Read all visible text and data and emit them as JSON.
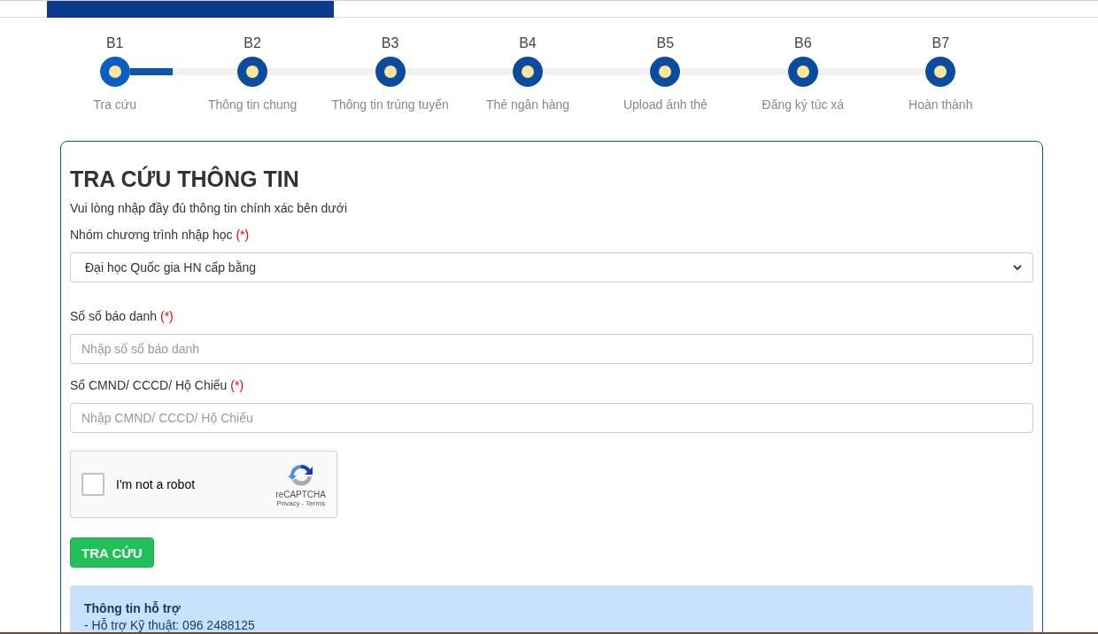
{
  "steps": [
    {
      "code": "B1",
      "label": "Tra cứu",
      "selected": true
    },
    {
      "code": "B2",
      "label": "Thông tin chung",
      "selected": false
    },
    {
      "code": "B3",
      "label": "Thông tin trúng tuyển",
      "selected": false
    },
    {
      "code": "B4",
      "label": "Thẻ ngân hàng",
      "selected": false
    },
    {
      "code": "B5",
      "label": "Upload ảnh thẻ",
      "selected": false
    },
    {
      "code": "B6",
      "label": "Đăng ký túc xá",
      "selected": false
    },
    {
      "code": "B7",
      "label": "Hoàn thành",
      "selected": false
    }
  ],
  "form": {
    "title": "TRA CỨU THÔNG TIN",
    "subtitle": "Vui lòng nhập đầy đủ thông tin chính xác bên dưới",
    "fields": [
      {
        "kind": "select",
        "label": "Nhóm chương trình nhập học",
        "required_mark": "(*)",
        "value": "Đại học Quốc gia HN cấp bằng"
      },
      {
        "kind": "input",
        "label": "Số số báo danh",
        "required_mark": "(*)",
        "placeholder": "Nhập số số báo danh"
      },
      {
        "kind": "input",
        "label": "Số CMND/ CCCD/ Hộ Chiếu",
        "required_mark": "(*)",
        "placeholder": "Nhập CMND/ CCCD/ Hộ Chiếu"
      }
    ],
    "captcha": {
      "label": "I'm not a robot",
      "checked": false,
      "brand": "reCAPTCHA",
      "links": "Privacy - Terms"
    },
    "submit": "TRA CỨU",
    "support": {
      "title": "Thông tin hỗ trợ",
      "lines": [
        "- Hỗ trợ Kỹ thuật: 096 2488125"
      ]
    }
  }
}
